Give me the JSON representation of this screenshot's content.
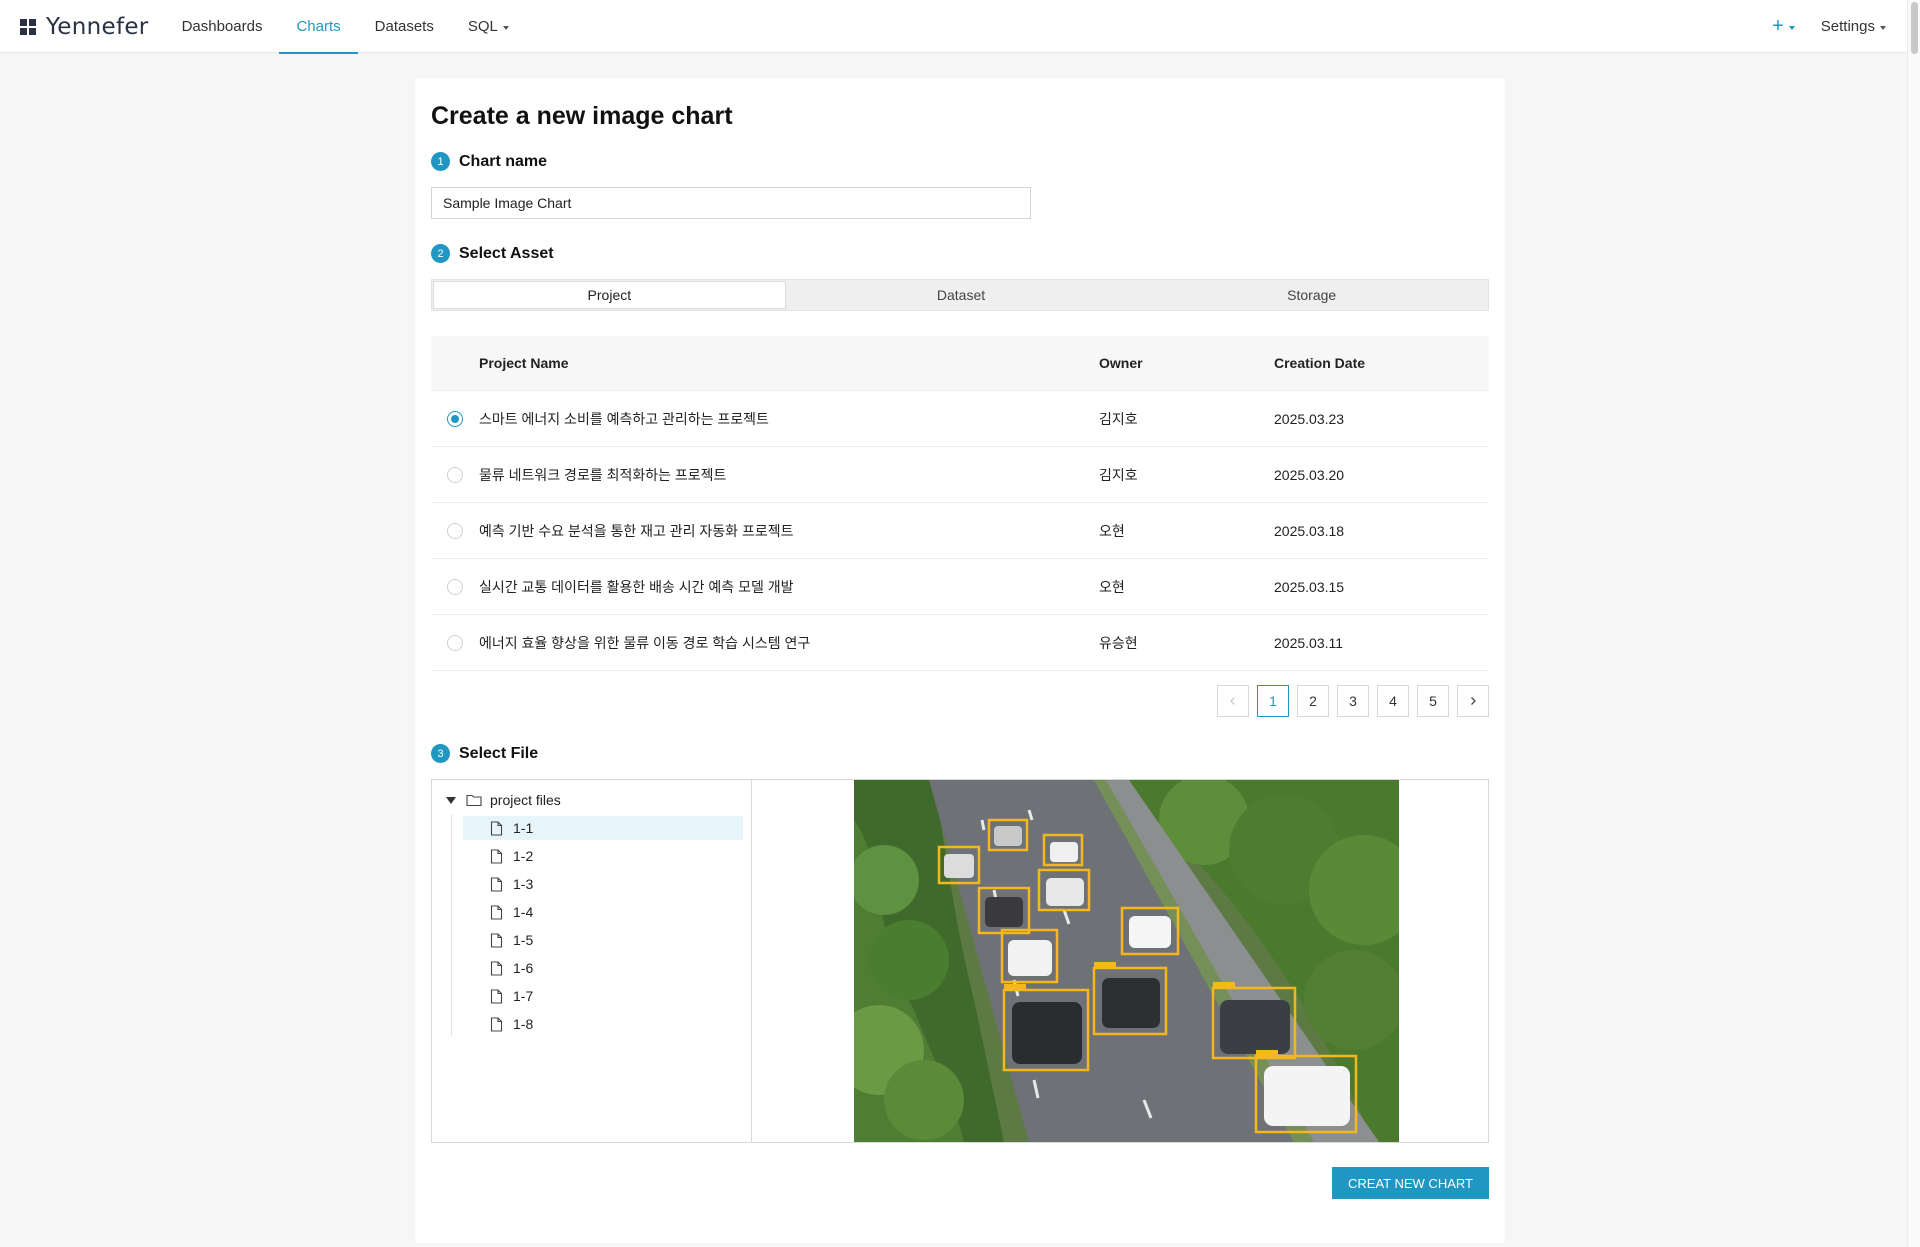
{
  "nav": {
    "logo": "Yennefer",
    "items": [
      {
        "label": "Dashboards",
        "active": false,
        "dropdown": false
      },
      {
        "label": "Charts",
        "active": true,
        "dropdown": false
      },
      {
        "label": "Datasets",
        "active": false,
        "dropdown": false
      },
      {
        "label": "SQL",
        "active": false,
        "dropdown": true
      }
    ],
    "add_label": "+",
    "settings_label": "Settings"
  },
  "page": {
    "title": "Create a new image chart"
  },
  "steps": {
    "chart_name": {
      "num": "1",
      "label": "Chart name",
      "value": "Sample Image Chart"
    },
    "select_asset": {
      "num": "2",
      "label": "Select Asset"
    },
    "select_file": {
      "num": "3",
      "label": "Select File"
    }
  },
  "asset_tabs": [
    {
      "label": "Project",
      "active": true
    },
    {
      "label": "Dataset",
      "active": false
    },
    {
      "label": "Storage",
      "active": false
    }
  ],
  "table": {
    "headers": {
      "name": "Project Name",
      "owner": "Owner",
      "date": "Creation Date"
    },
    "rows": [
      {
        "name": "스마트 에너지 소비를 예측하고 관리하는 프로젝트",
        "owner": "김지호",
        "date": "2025.03.23",
        "selected": true
      },
      {
        "name": "물류 네트워크 경로를 최적화하는 프로젝트",
        "owner": "김지호",
        "date": "2025.03.20",
        "selected": false
      },
      {
        "name": "예측 기반 수요 분석을 통한 재고 관리 자동화 프로젝트",
        "owner": "오현",
        "date": "2025.03.18",
        "selected": false
      },
      {
        "name": "실시간 교통 데이터를 활용한 배송 시간 예측 모델 개발",
        "owner": "오현",
        "date": "2025.03.15",
        "selected": false
      },
      {
        "name": "에너지 효율 향상을 위한 물류 이동 경로 학습 시스템 연구",
        "owner": "유승현",
        "date": "2025.03.11",
        "selected": false
      }
    ]
  },
  "pagination": {
    "pages": [
      "1",
      "2",
      "3",
      "4",
      "5"
    ],
    "current": "1"
  },
  "files": {
    "folder": "project files",
    "items": [
      "1-1",
      "1-2",
      "1-3",
      "1-4",
      "1-5",
      "1-6",
      "1-7",
      "1-8"
    ],
    "selected": "1-1"
  },
  "actions": {
    "create_label": "CREAT NEW CHART"
  },
  "colors": {
    "accent": "#1f97c2",
    "bbox": "#f5b81c"
  }
}
